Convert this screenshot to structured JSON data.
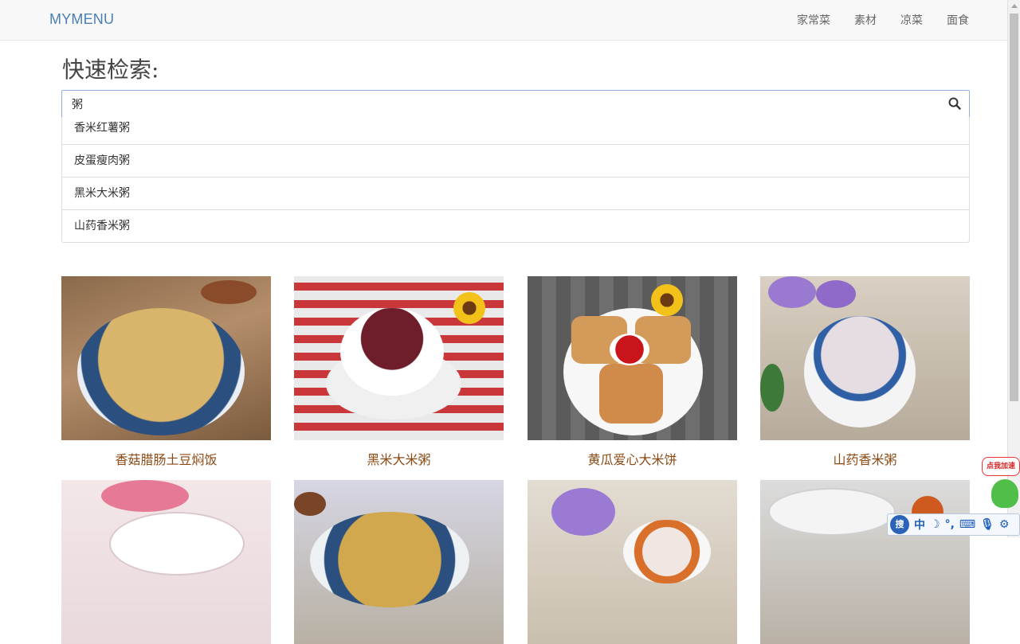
{
  "navbar": {
    "brand": "MYMENU",
    "links": [
      "家常菜",
      "素材",
      "凉菜",
      "面食"
    ]
  },
  "search": {
    "title": "快速检索:",
    "value": "粥",
    "suggestions": [
      "香米红薯粥",
      "皮蛋瘦肉粥",
      "黑米大米粥",
      "山药香米粥"
    ]
  },
  "recipes": [
    {
      "title": "香菇腊肠土豆焖饭"
    },
    {
      "title": "黑米大米粥"
    },
    {
      "title": "黄瓜爱心大米饼"
    },
    {
      "title": "山药香米粥"
    }
  ],
  "float_widget": {
    "label": "点我加速"
  },
  "ime": {
    "logo": "搜",
    "mode": "中"
  },
  "colors": {
    "brand": "#4a7fb5",
    "recipe_title": "#8b4a14",
    "search_border": "#8eb2e0"
  }
}
